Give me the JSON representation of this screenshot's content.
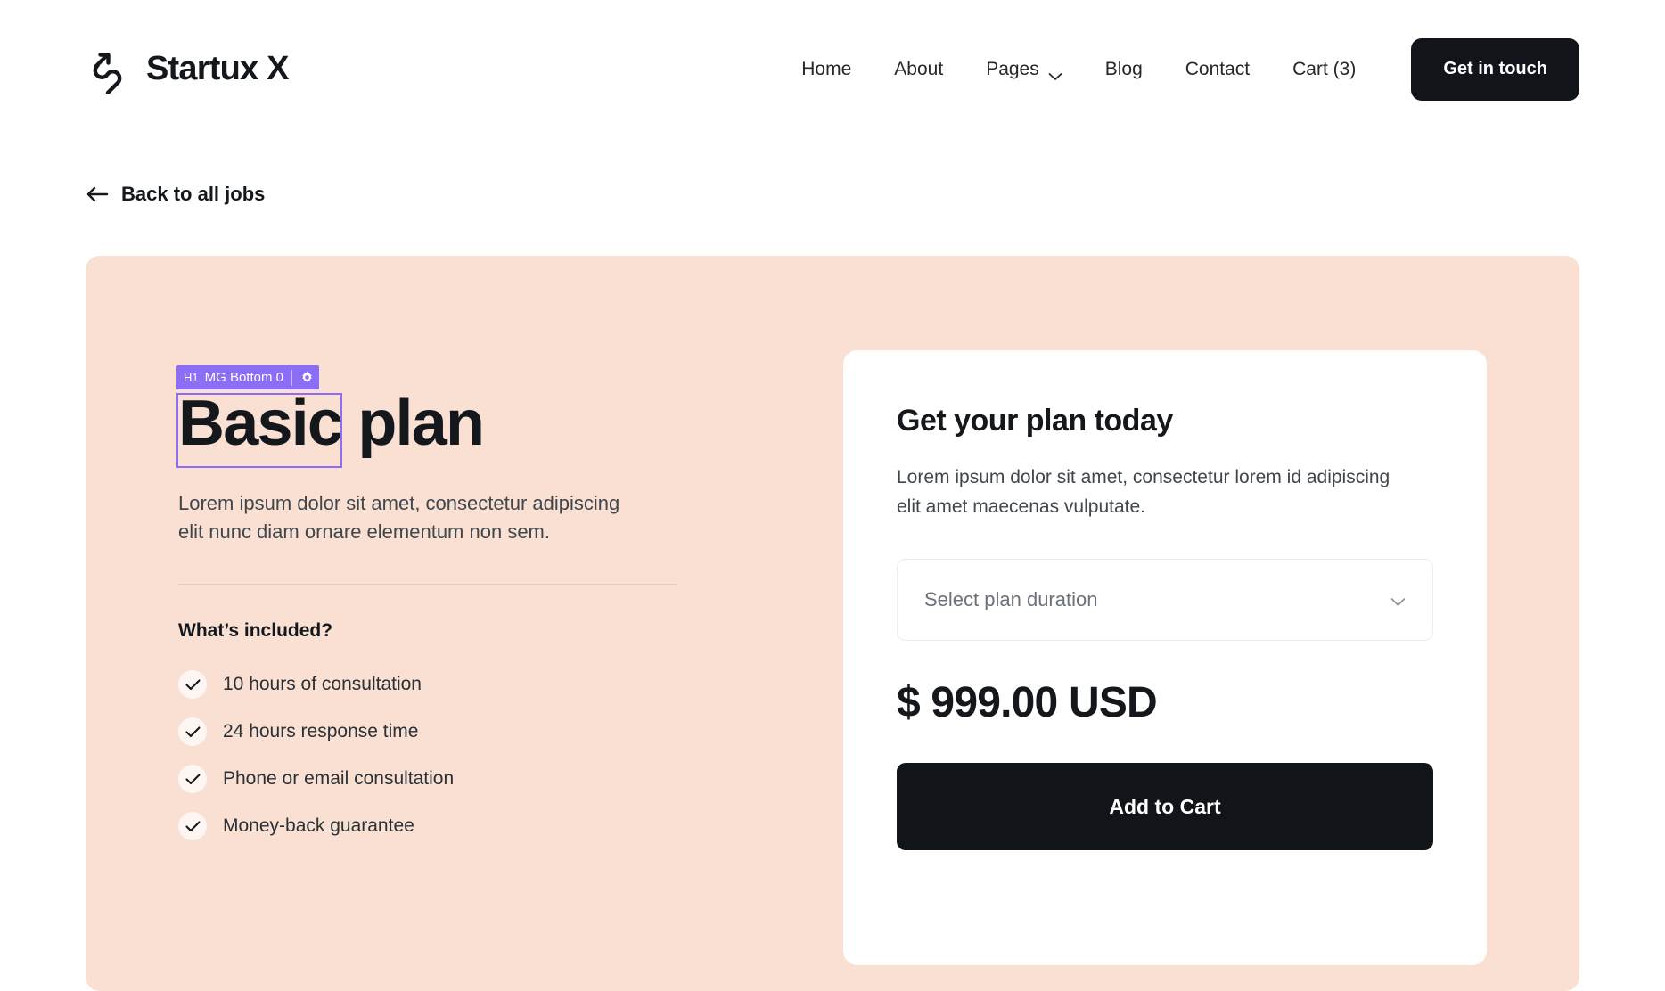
{
  "header": {
    "brand": {
      "name": "Startux X",
      "logo_icon": "arrow-swoosh-logo-icon"
    },
    "nav_items": [
      {
        "label": "Home",
        "icon": null
      },
      {
        "label": "About",
        "icon": null
      },
      {
        "label": "Pages",
        "icon": "chevron-down-icon"
      },
      {
        "label": "Blog",
        "icon": null
      },
      {
        "label": "Contact",
        "icon": null
      },
      {
        "label": "Cart (3)",
        "icon": null
      }
    ],
    "cta_label": "Get in touch"
  },
  "back_link": {
    "label": "Back to all jobs",
    "icon": "arrow-left-icon"
  },
  "hero": {
    "background_color": "#F9E0D2",
    "plan_title": "Basic plan",
    "plan_description": "Lorem ipsum dolor sit amet, consectetur adipiscing elit nunc diam ornare elementum non sem.",
    "included_title": "What’s included?",
    "features": [
      "10 hours of consultation",
      "24 hours response time",
      "Phone or email consultation",
      "Money-back guarantee"
    ]
  },
  "editor_overlay": {
    "accent_color": "#8B6DF6",
    "tag": "H1",
    "label": "MG Bottom 0",
    "settings_icon": "gear-icon"
  },
  "plan_card": {
    "title": "Get your plan today",
    "description": "Lorem ipsum dolor sit amet, consectetur lorem id adipiscing elit amet maecenas vulputate.",
    "select_placeholder": "Select plan duration",
    "select_caret_icon": "chevron-down-icon",
    "price": "$ 999.00 USD",
    "add_to_cart_label": "Add to Cart"
  }
}
